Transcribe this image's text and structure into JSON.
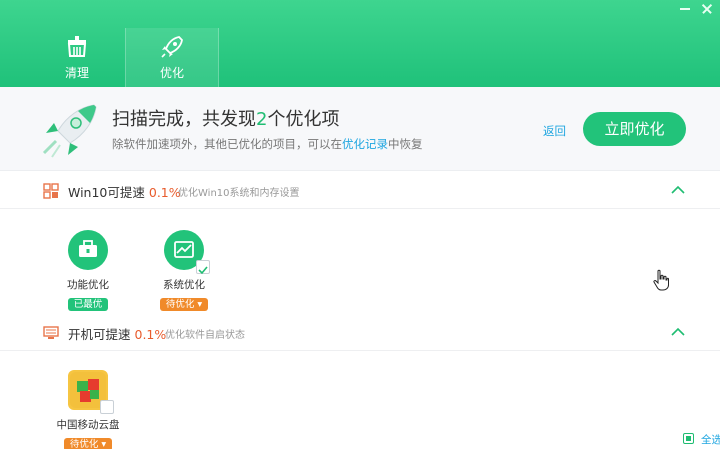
{
  "window": {
    "min_icon": "minimize-icon",
    "close_icon": "close-icon"
  },
  "tabs": [
    {
      "label": "清理",
      "icon": "broom-icon"
    },
    {
      "label": "优化",
      "icon": "rocket-icon"
    }
  ],
  "banner": {
    "title_prefix": "扫描完成，共发现",
    "title_count": "2",
    "title_suffix": "个优化项",
    "subtitle_prefix": "除软件加速项外，其他已优化的项目，可以在",
    "subtitle_link": "优化记录",
    "subtitle_suffix": "中恢复",
    "back_label": "返回",
    "optimize_label": "立即优化"
  },
  "sections": [
    {
      "title": "Win10可提速",
      "percent": "0.1%",
      "desc": "优化Win10系统和内存设置",
      "items": [
        {
          "name": "功能优化",
          "badge": "已最优"
        },
        {
          "name": "系统优化",
          "badge": "待优化 ▾"
        }
      ]
    },
    {
      "title": "开机可提速",
      "percent": "0.1%",
      "desc": "优化软件自启状态",
      "items": [
        {
          "name": "中国移动云盘",
          "badge": "待优化 ▾"
        }
      ]
    }
  ],
  "footer": {
    "select_all_label": "全选"
  },
  "colors": {
    "brand_green": "#22c37a",
    "link_blue": "#1fa6e0",
    "accent_orange": "#f08a2a",
    "percent_red": "#e85b2c"
  }
}
